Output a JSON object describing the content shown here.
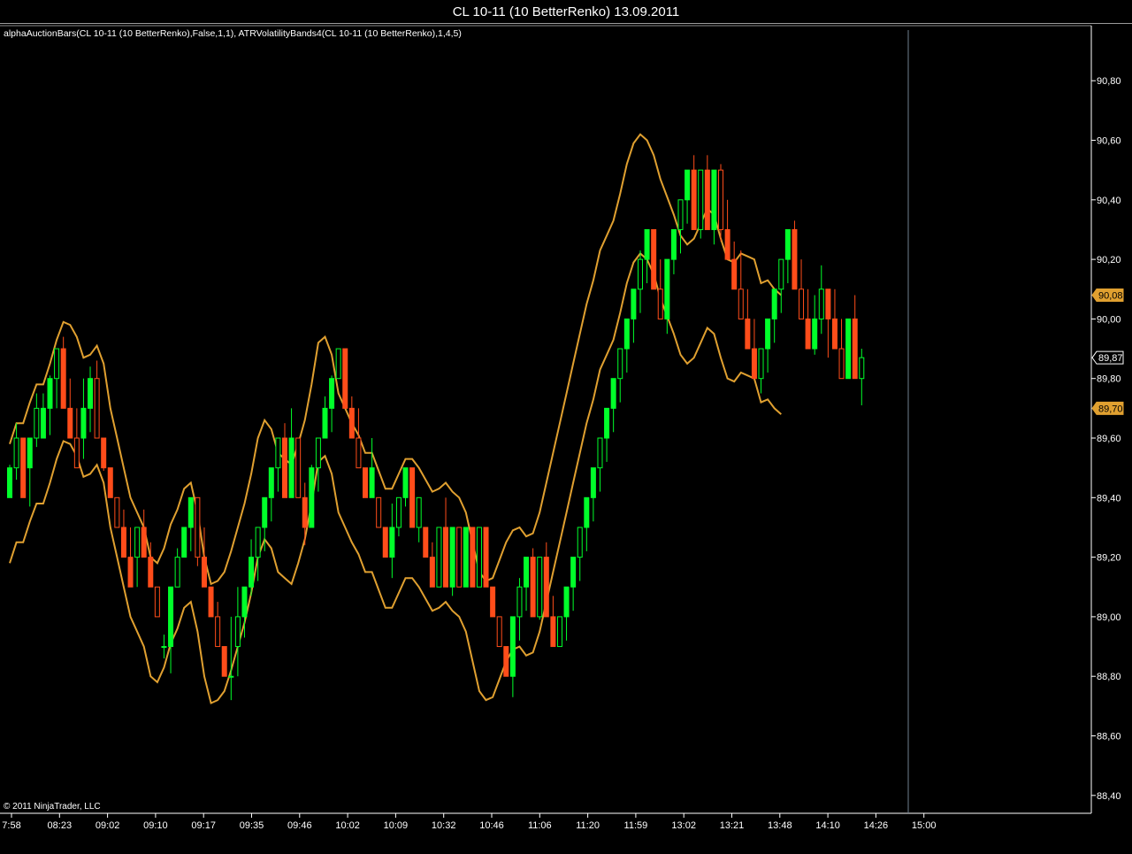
{
  "window": {
    "title": "CL 10-11 (10 BetterRenko)  13.09.2011"
  },
  "indicators_label": "alphaAuctionBars(CL 10-11 (10 BetterRenko),False,1,1), ATRVolatilityBands4(CL 10-11 (10 BetterRenko),1,4,5)",
  "copyright": "© 2011 NinjaTrader, LLC",
  "colors": {
    "background": "#000000",
    "up_bar": "#00ff2a",
    "down_bar": "#ff4d1a",
    "band": "#e0a030",
    "axis": "#ffffff",
    "cursor_line": "#6f7f8f"
  },
  "chart_data": {
    "type": "candlestick",
    "symbol": "CL 10-11",
    "timeframe": "10 BetterRenko",
    "date": "13.09.2011",
    "ylim": [
      88.34,
      90.97
    ],
    "y_ticks": [
      "90,80",
      "90,60",
      "90,40",
      "90,20",
      "90,00",
      "89,80",
      "89,60",
      "89,40",
      "89,20",
      "89,00",
      "88,80",
      "88,60",
      "88,40"
    ],
    "x_ticks": [
      "7:58",
      "08:23",
      "09:02",
      "09:10",
      "09:17",
      "09:35",
      "09:46",
      "10:02",
      "10:09",
      "10:32",
      "10:46",
      "11:06",
      "11:20",
      "11:59",
      "13:02",
      "13:21",
      "13:48",
      "14:10",
      "14:26",
      "15:00"
    ],
    "price_markers": [
      {
        "label": "90,08",
        "value": 90.08,
        "style": "band"
      },
      {
        "label": "89,87",
        "value": 89.87,
        "style": "last"
      },
      {
        "label": "89,70",
        "value": 89.7,
        "style": "band"
      }
    ],
    "bars": [
      {
        "o": 89.4,
        "c": 89.5,
        "h": 89.51,
        "l": 89.4
      },
      {
        "o": 89.5,
        "c": 89.6,
        "h": 89.65,
        "l": 89.46
      },
      {
        "o": 89.6,
        "c": 89.4,
        "h": 89.6,
        "l": 89.4
      },
      {
        "o": 89.5,
        "c": 89.6,
        "h": 89.6,
        "l": 89.37
      },
      {
        "o": 89.6,
        "c": 89.7,
        "h": 89.75,
        "l": 89.57
      },
      {
        "o": 89.6,
        "c": 89.7,
        "h": 89.75,
        "l": 89.6
      },
      {
        "o": 89.7,
        "c": 89.8,
        "h": 89.81,
        "l": 89.61
      },
      {
        "o": 89.8,
        "c": 89.9,
        "h": 89.9,
        "l": 89.7
      },
      {
        "o": 89.9,
        "c": 89.7,
        "h": 89.94,
        "l": 89.7
      },
      {
        "o": 89.7,
        "c": 89.6,
        "h": 89.8,
        "l": 89.6
      },
      {
        "o": 89.6,
        "c": 89.5,
        "h": 89.7,
        "l": 89.5
      },
      {
        "o": 89.6,
        "c": 89.7,
        "h": 89.8,
        "l": 89.53
      },
      {
        "o": 89.7,
        "c": 89.8,
        "h": 89.84,
        "l": 89.62
      },
      {
        "o": 89.8,
        "c": 89.6,
        "h": 89.86,
        "l": 89.6
      },
      {
        "o": 89.6,
        "c": 89.5,
        "h": 89.6,
        "l": 89.49
      },
      {
        "o": 89.5,
        "c": 89.4,
        "h": 89.5,
        "l": 89.4
      },
      {
        "o": 89.4,
        "c": 89.3,
        "h": 89.4,
        "l": 89.3
      },
      {
        "o": 89.3,
        "c": 89.2,
        "h": 89.36,
        "l": 89.2
      },
      {
        "o": 89.2,
        "c": 89.1,
        "h": 89.3,
        "l": 89.1
      },
      {
        "o": 89.2,
        "c": 89.3,
        "h": 89.3,
        "l": 89.1
      },
      {
        "o": 89.3,
        "c": 89.2,
        "h": 89.36,
        "l": 89.2
      },
      {
        "o": 89.2,
        "c": 89.1,
        "h": 89.25,
        "l": 89.1
      },
      {
        "o": 89.1,
        "c": 89.0,
        "h": 89.1,
        "l": 89.0
      },
      {
        "o": 88.9,
        "c": 88.9,
        "h": 88.94,
        "l": 88.86
      },
      {
        "o": 88.9,
        "c": 89.1,
        "h": 89.1,
        "l": 88.81
      },
      {
        "o": 89.1,
        "c": 89.2,
        "h": 89.23,
        "l": 89.1
      },
      {
        "o": 89.2,
        "c": 89.3,
        "h": 89.3,
        "l": 89.2
      },
      {
        "o": 89.3,
        "c": 89.4,
        "h": 89.4,
        "l": 89.22
      },
      {
        "o": 89.4,
        "c": 89.2,
        "h": 89.4,
        "l": 89.17
      },
      {
        "o": 89.2,
        "c": 89.1,
        "h": 89.3,
        "l": 89.1
      },
      {
        "o": 89.1,
        "c": 89.0,
        "h": 89.1,
        "l": 89.0
      },
      {
        "o": 89.0,
        "c": 88.9,
        "h": 89.05,
        "l": 88.9
      },
      {
        "o": 88.9,
        "c": 88.8,
        "h": 88.9,
        "l": 88.8
      },
      {
        "o": 88.8,
        "c": 88.8,
        "h": 89.0,
        "l": 88.72
      },
      {
        "o": 88.9,
        "c": 89.0,
        "h": 89.1,
        "l": 88.8
      },
      {
        "o": 89.0,
        "c": 89.1,
        "h": 89.1,
        "l": 88.93
      },
      {
        "o": 89.1,
        "c": 89.2,
        "h": 89.26,
        "l": 89.07
      },
      {
        "o": 89.2,
        "c": 89.3,
        "h": 89.3,
        "l": 89.12
      },
      {
        "o": 89.3,
        "c": 89.4,
        "h": 89.4,
        "l": 89.22
      },
      {
        "o": 89.4,
        "c": 89.5,
        "h": 89.5,
        "l": 89.32
      },
      {
        "o": 89.5,
        "c": 89.6,
        "h": 89.6,
        "l": 89.42
      },
      {
        "o": 89.6,
        "c": 89.4,
        "h": 89.65,
        "l": 89.4
      },
      {
        "o": 89.4,
        "c": 89.6,
        "h": 89.7,
        "l": 89.4
      },
      {
        "o": 89.6,
        "c": 89.4,
        "h": 89.6,
        "l": 89.4
      },
      {
        "o": 89.4,
        "c": 89.3,
        "h": 89.45,
        "l": 89.24
      },
      {
        "o": 89.3,
        "c": 89.5,
        "h": 89.51,
        "l": 89.3
      },
      {
        "o": 89.5,
        "c": 89.6,
        "h": 89.6,
        "l": 89.42
      },
      {
        "o": 89.6,
        "c": 89.7,
        "h": 89.74,
        "l": 89.6
      },
      {
        "o": 89.7,
        "c": 89.8,
        "h": 89.81,
        "l": 89.62
      },
      {
        "o": 89.8,
        "c": 89.9,
        "h": 89.9,
        "l": 89.8
      },
      {
        "o": 89.9,
        "c": 89.7,
        "h": 89.9,
        "l": 89.7
      },
      {
        "o": 89.7,
        "c": 89.6,
        "h": 89.74,
        "l": 89.6
      },
      {
        "o": 89.6,
        "c": 89.5,
        "h": 89.7,
        "l": 89.5
      },
      {
        "o": 89.5,
        "c": 89.4,
        "h": 89.5,
        "l": 89.4
      },
      {
        "o": 89.4,
        "c": 89.5,
        "h": 89.6,
        "l": 89.4
      },
      {
        "o": 89.4,
        "c": 89.3,
        "h": 89.4,
        "l": 89.3
      },
      {
        "o": 89.3,
        "c": 89.2,
        "h": 89.3,
        "l": 89.2
      },
      {
        "o": 89.2,
        "c": 89.3,
        "h": 89.38,
        "l": 89.13
      },
      {
        "o": 89.3,
        "c": 89.4,
        "h": 89.4,
        "l": 89.27
      },
      {
        "o": 89.4,
        "c": 89.5,
        "h": 89.5,
        "l": 89.37
      },
      {
        "o": 89.5,
        "c": 89.3,
        "h": 89.5,
        "l": 89.3
      },
      {
        "o": 89.3,
        "c": 89.4,
        "h": 89.4,
        "l": 89.25
      },
      {
        "o": 89.3,
        "c": 89.2,
        "h": 89.3,
        "l": 89.2
      },
      {
        "o": 89.2,
        "c": 89.1,
        "h": 89.25,
        "l": 89.1
      },
      {
        "o": 89.1,
        "c": 89.3,
        "h": 89.3,
        "l": 89.1
      },
      {
        "o": 89.3,
        "c": 89.1,
        "h": 89.4,
        "l": 89.1
      },
      {
        "o": 89.1,
        "c": 89.3,
        "h": 89.3,
        "l": 89.07
      },
      {
        "o": 89.3,
        "c": 89.1,
        "h": 89.3,
        "l": 89.1
      },
      {
        "o": 89.1,
        "c": 89.3,
        "h": 89.3,
        "l": 89.1
      },
      {
        "o": 89.3,
        "c": 89.1,
        "h": 89.3,
        "l": 89.1
      },
      {
        "o": 89.1,
        "c": 89.3,
        "h": 89.3,
        "l": 89.1
      },
      {
        "o": 89.3,
        "c": 89.1,
        "h": 89.3,
        "l": 89.1
      },
      {
        "o": 89.1,
        "c": 89.0,
        "h": 89.1,
        "l": 89.0
      },
      {
        "o": 89.0,
        "c": 88.9,
        "h": 89.0,
        "l": 88.9
      },
      {
        "o": 88.9,
        "c": 88.8,
        "h": 88.9,
        "l": 88.8
      },
      {
        "o": 88.8,
        "c": 89.0,
        "h": 89.0,
        "l": 88.73
      },
      {
        "o": 89.0,
        "c": 89.1,
        "h": 89.13,
        "l": 88.92
      },
      {
        "o": 89.1,
        "c": 89.2,
        "h": 89.2,
        "l": 89.02
      },
      {
        "o": 89.2,
        "c": 89.0,
        "h": 89.23,
        "l": 89.0
      },
      {
        "o": 89.0,
        "c": 89.2,
        "h": 89.2,
        "l": 88.99
      },
      {
        "o": 89.2,
        "c": 89.0,
        "h": 89.25,
        "l": 89.0
      },
      {
        "o": 89.0,
        "c": 88.9,
        "h": 89.07,
        "l": 88.9
      },
      {
        "o": 88.9,
        "c": 89.0,
        "h": 89.0,
        "l": 88.9
      },
      {
        "o": 89.0,
        "c": 89.1,
        "h": 89.1,
        "l": 88.92
      },
      {
        "o": 89.1,
        "c": 89.2,
        "h": 89.2,
        "l": 89.02
      },
      {
        "o": 89.2,
        "c": 89.3,
        "h": 89.3,
        "l": 89.12
      },
      {
        "o": 89.3,
        "c": 89.4,
        "h": 89.4,
        "l": 89.22
      },
      {
        "o": 89.4,
        "c": 89.5,
        "h": 89.5,
        "l": 89.32
      },
      {
        "o": 89.5,
        "c": 89.6,
        "h": 89.6,
        "l": 89.42
      },
      {
        "o": 89.6,
        "c": 89.7,
        "h": 89.7,
        "l": 89.52
      },
      {
        "o": 89.7,
        "c": 89.8,
        "h": 89.8,
        "l": 89.62
      },
      {
        "o": 89.8,
        "c": 89.9,
        "h": 89.9,
        "l": 89.72
      },
      {
        "o": 89.9,
        "c": 90.0,
        "h": 90.0,
        "l": 89.82
      },
      {
        "o": 90.0,
        "c": 90.1,
        "h": 90.1,
        "l": 89.92
      },
      {
        "o": 90.1,
        "c": 90.2,
        "h": 90.23,
        "l": 90.02
      },
      {
        "o": 90.2,
        "c": 90.3,
        "h": 90.3,
        "l": 90.12
      },
      {
        "o": 90.3,
        "c": 90.1,
        "h": 90.3,
        "l": 90.1
      },
      {
        "o": 90.1,
        "c": 90.0,
        "h": 90.2,
        "l": 90.0
      },
      {
        "o": 90.0,
        "c": 90.2,
        "h": 90.2,
        "l": 89.95
      },
      {
        "o": 90.2,
        "c": 90.3,
        "h": 90.3,
        "l": 90.15
      },
      {
        "o": 90.3,
        "c": 90.4,
        "h": 90.4,
        "l": 90.22
      },
      {
        "o": 90.4,
        "c": 90.5,
        "h": 90.5,
        "l": 90.32
      },
      {
        "o": 90.5,
        "c": 90.3,
        "h": 90.55,
        "l": 90.3
      },
      {
        "o": 90.3,
        "c": 90.5,
        "h": 90.5,
        "l": 90.27
      },
      {
        "o": 90.5,
        "c": 90.3,
        "h": 90.55,
        "l": 90.3
      },
      {
        "o": 90.3,
        "c": 90.5,
        "h": 90.5,
        "l": 90.25
      },
      {
        "o": 90.5,
        "c": 90.3,
        "h": 90.52,
        "l": 90.26
      },
      {
        "o": 90.3,
        "c": 90.2,
        "h": 90.4,
        "l": 90.2
      },
      {
        "o": 90.2,
        "c": 90.1,
        "h": 90.26,
        "l": 90.1
      },
      {
        "o": 90.1,
        "c": 90.0,
        "h": 90.23,
        "l": 90.0
      },
      {
        "o": 90.0,
        "c": 89.9,
        "h": 90.1,
        "l": 89.9
      },
      {
        "o": 89.9,
        "c": 89.8,
        "h": 90.0,
        "l": 89.8
      },
      {
        "o": 89.8,
        "c": 89.9,
        "h": 89.9,
        "l": 89.75
      },
      {
        "o": 89.9,
        "c": 90.0,
        "h": 90.0,
        "l": 89.82
      },
      {
        "o": 90.0,
        "c": 90.1,
        "h": 90.1,
        "l": 89.92
      },
      {
        "o": 90.1,
        "c": 90.2,
        "h": 90.2,
        "l": 90.02
      },
      {
        "o": 90.2,
        "c": 90.3,
        "h": 90.3,
        "l": 90.12
      },
      {
        "o": 90.3,
        "c": 90.1,
        "h": 90.33,
        "l": 90.1
      },
      {
        "o": 90.1,
        "c": 90.0,
        "h": 90.2,
        "l": 90.0
      },
      {
        "o": 90.0,
        "c": 89.9,
        "h": 90.1,
        "l": 89.9
      },
      {
        "o": 89.9,
        "c": 90.0,
        "h": 90.08,
        "l": 89.88
      },
      {
        "o": 90.0,
        "c": 90.1,
        "h": 90.18,
        "l": 89.95
      },
      {
        "o": 90.1,
        "c": 90.0,
        "h": 90.1,
        "l": 89.87
      },
      {
        "o": 90.0,
        "c": 89.9,
        "h": 90.1,
        "l": 89.9
      },
      {
        "o": 89.9,
        "c": 89.8,
        "h": 90.0,
        "l": 89.8
      },
      {
        "o": 89.8,
        "c": 90.0,
        "h": 90.0,
        "l": 89.8
      },
      {
        "o": 90.0,
        "c": 89.8,
        "h": 90.08,
        "l": 89.8
      },
      {
        "o": 89.8,
        "c": 89.87,
        "h": 89.9,
        "l": 89.71
      }
    ],
    "upper_band": [
      89.58,
      89.65,
      89.65,
      89.72,
      89.78,
      89.78,
      89.85,
      89.93,
      89.99,
      89.98,
      89.94,
      89.87,
      89.88,
      89.91,
      89.85,
      89.7,
      89.6,
      89.5,
      89.4,
      89.35,
      89.3,
      89.2,
      89.18,
      89.23,
      89.31,
      89.36,
      89.43,
      89.45,
      89.35,
      89.2,
      89.11,
      89.12,
      89.15,
      89.22,
      89.3,
      89.38,
      89.48,
      89.6,
      89.66,
      89.63,
      89.55,
      89.53,
      89.51,
      89.58,
      89.66,
      89.78,
      89.92,
      89.94,
      89.88,
      89.75,
      89.7,
      89.65,
      89.61,
      89.55,
      89.55,
      89.49,
      89.43,
      89.43,
      89.48,
      89.53,
      89.53,
      89.5,
      89.46,
      89.42,
      89.43,
      89.45,
      89.42,
      89.4,
      89.35,
      89.25,
      89.15,
      89.12,
      89.13,
      89.19,
      89.25,
      89.29,
      89.3,
      89.27,
      89.28,
      89.35,
      89.45,
      89.55,
      89.65,
      89.75,
      89.85,
      89.95,
      90.05,
      90.13,
      90.23,
      90.28,
      90.33,
      90.42,
      90.52,
      90.59,
      90.62,
      90.6,
      90.55,
      90.47,
      90.41,
      90.35,
      90.28,
      90.25,
      90.27,
      90.32,
      90.37,
      90.35,
      90.27,
      90.2,
      90.19,
      90.22,
      90.21,
      90.2,
      90.12,
      90.13,
      90.1,
      90.08
    ]
  }
}
